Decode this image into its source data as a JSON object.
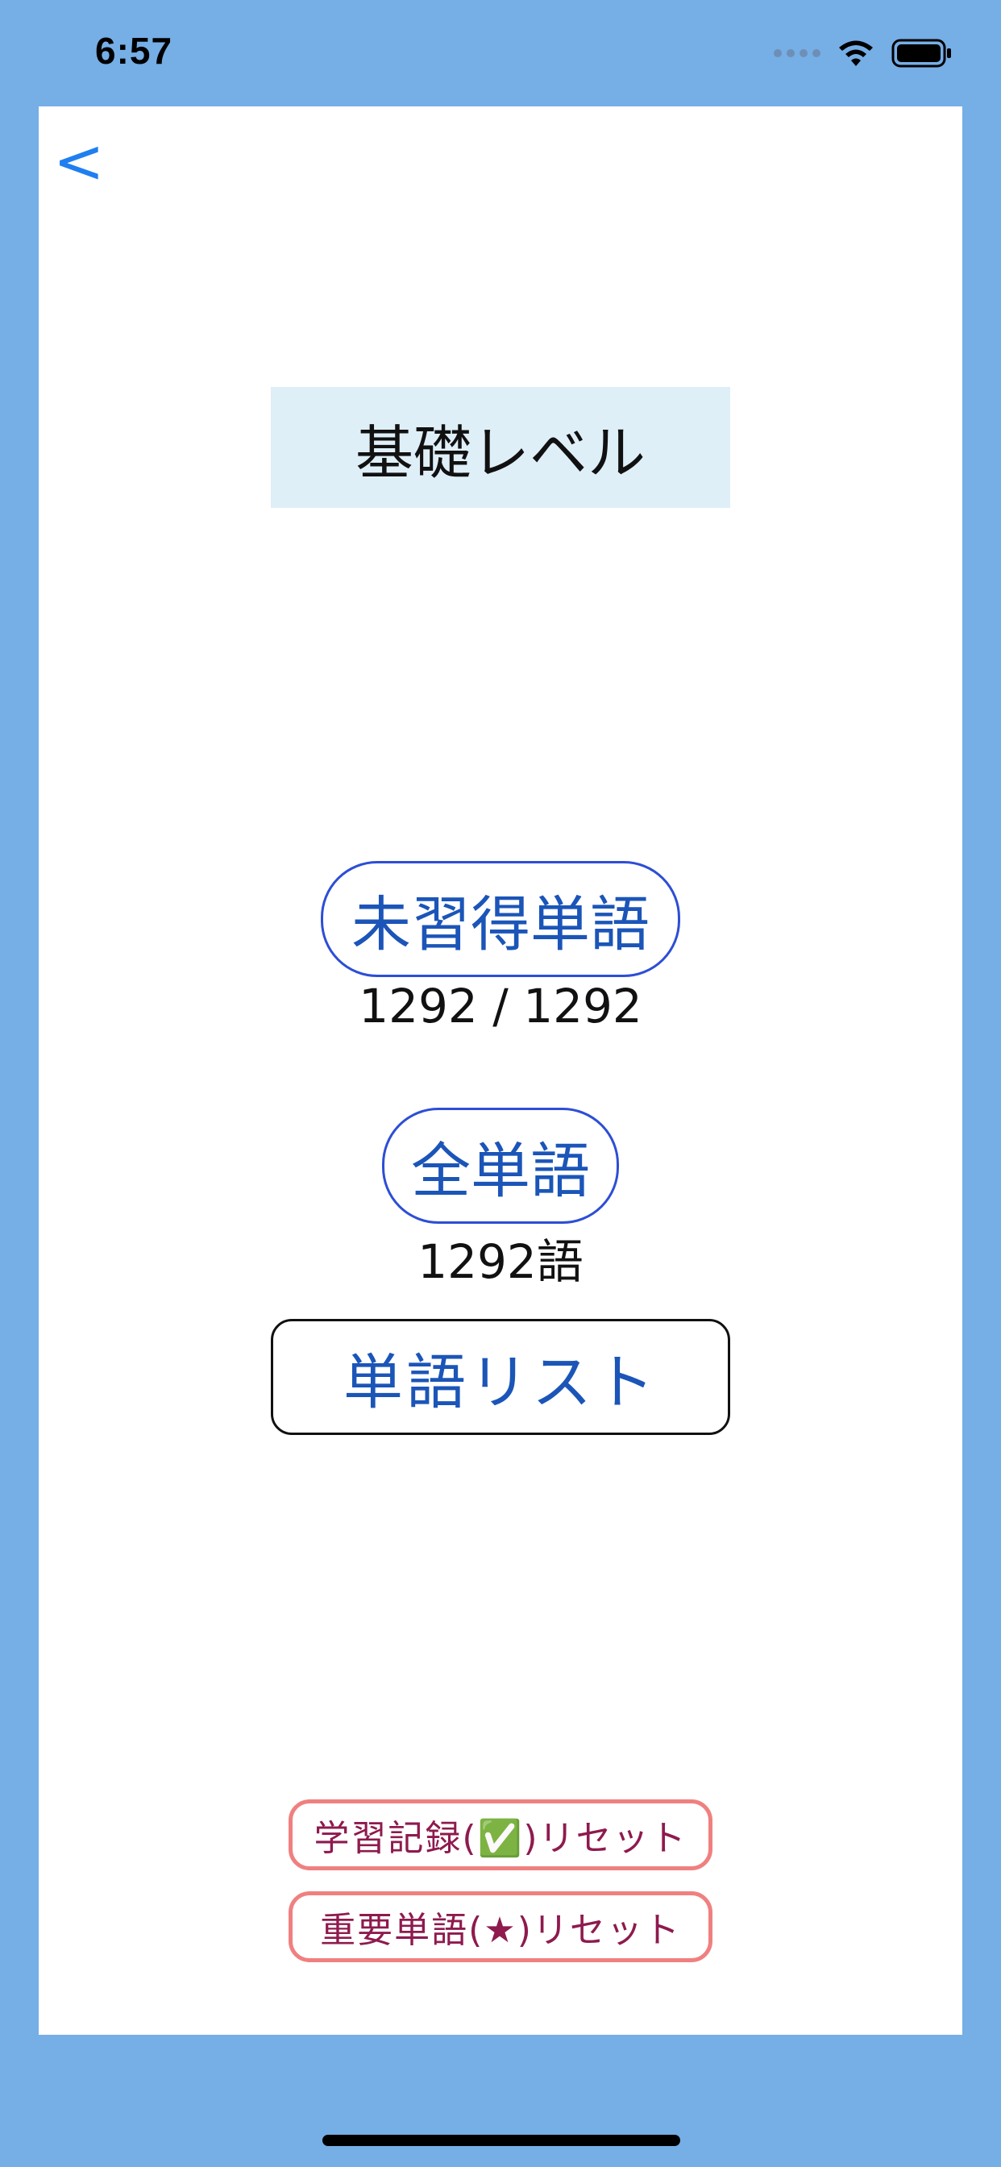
{
  "status_bar": {
    "time": "6:57"
  },
  "navigation": {
    "back_label": "<"
  },
  "screen": {
    "title": "基礎レベル",
    "unlearned_button_label": "未習得単語",
    "unlearned_count": "1292 / 1292",
    "all_words_button_label": "全単語",
    "all_words_count": "1292語",
    "word_list_button_label": "単語リスト",
    "reset_history_label": "学習記録(✅)リセット",
    "reset_important_label": "重要単語(★)リセット"
  },
  "colors": {
    "background": "#76aee6",
    "panel": "#ffffff",
    "accent": "#1f7ff0",
    "button_text": "#1b55b8",
    "reset_border": "#f08080",
    "reset_text": "#8e1a4e"
  },
  "icons": [
    "wifi-icon",
    "battery-icon",
    "signal-icon"
  ]
}
